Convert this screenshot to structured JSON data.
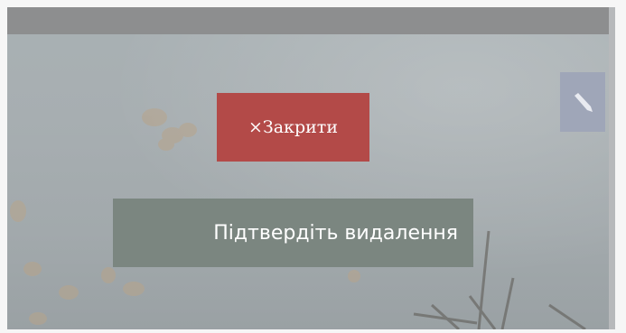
{
  "dialog": {
    "close_label": "×Закрити",
    "message": "Підтвердіть видалення"
  },
  "icons": {
    "edit": "pencil-icon"
  },
  "colors": {
    "close_button": "#b34a48",
    "message_bg": "#7b8680",
    "top_bar": "#8d8e8f",
    "edit_button": "#9fa6b8"
  }
}
